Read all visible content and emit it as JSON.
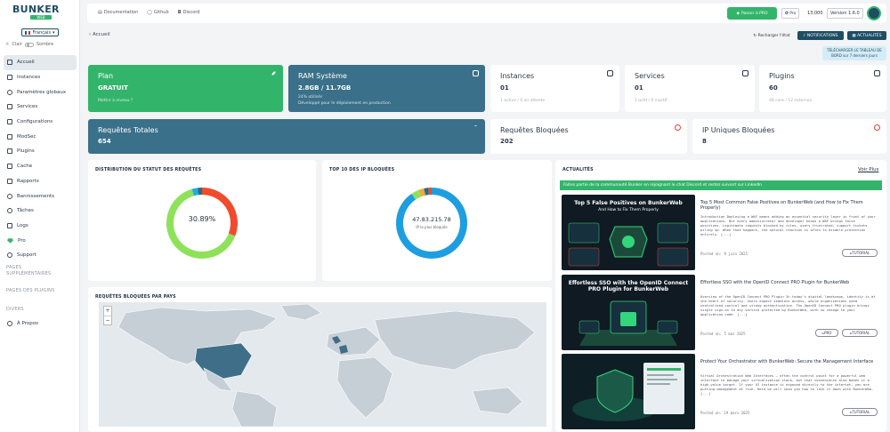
{
  "sidebar": {
    "logo": "BUNKER",
    "logo_badge": "WEB",
    "language": "Français",
    "theme_light": "Clair",
    "theme_dark": "Sombre",
    "items": [
      {
        "label": "Accueil",
        "icon": "home-icon",
        "active": true
      },
      {
        "label": "Instances",
        "icon": "server-icon"
      },
      {
        "label": "Paramètres globaux",
        "icon": "globe-icon"
      },
      {
        "label": "Services",
        "icon": "grid-icon"
      },
      {
        "label": "Configurations",
        "icon": "file-icon"
      },
      {
        "label": "ModSec",
        "icon": "shield-icon"
      },
      {
        "label": "Plugins",
        "icon": "puzzle-icon"
      },
      {
        "label": "Cache",
        "icon": "database-icon"
      },
      {
        "label": "Rapports",
        "icon": "flag-icon"
      },
      {
        "label": "Bannissements",
        "icon": "ban-icon"
      },
      {
        "label": "Tâches",
        "icon": "clock-icon"
      },
      {
        "label": "Logs",
        "icon": "list-icon"
      },
      {
        "label": "Pro",
        "icon": "diamond-icon"
      },
      {
        "label": "Support",
        "icon": "support-icon"
      }
    ],
    "section_extra": "PAGES SUPPLÉMENTAIRES",
    "section_plugins": "PAGES DES PLUGINS",
    "section_misc": "DIVERS",
    "about": "À Propos"
  },
  "topbar": {
    "links": [
      "Documentation",
      "Github",
      "Discord"
    ],
    "pro_button": "Passer à PRO",
    "plan_pill": "Pro",
    "counter": "13,000",
    "version": "Version 1.6.0"
  },
  "breadcrumb": "Accueil",
  "actions": {
    "refresh": "Recharger l'état",
    "notifications": "NOTIFICATIONS",
    "news": "ACTUALITÉS"
  },
  "notice": "TÉLÉCHARGER LE TABLEAU DE BORD sur 7 derniers jours",
  "cards": {
    "plan": {
      "title": "Plan",
      "value": "GRATUIT",
      "sub": "Mettre à niveau ?"
    },
    "ram": {
      "title": "RAM Système",
      "value": "2.8GB / 11.7GB",
      "sub1": "24% utilisés",
      "sub2": "Développé pour le déploiement en production"
    },
    "instances": {
      "title": "Instances",
      "value": "01",
      "sub": "1 active / 0 en attente"
    },
    "services": {
      "title": "Services",
      "value": "01",
      "sub": "1 actif / 0 inactif"
    },
    "plugins": {
      "title": "Plugins",
      "value": "60",
      "sub": "48 core / 12 externes"
    },
    "requests": {
      "title": "Requêtes Totales",
      "value": "654"
    },
    "blocked": {
      "title": "Requêtes Bloquées",
      "value": "202"
    },
    "unique_ips": {
      "title": "IP Uniques Bloquées",
      "value": "8"
    }
  },
  "panels": {
    "status_title": "DISTRIBUTION DU STATUT DES REQUÊTES",
    "status_center": "30.89%",
    "top_ip_title": "TOP 10 DES IP BLOQUÉES",
    "top_ip_center": "47.83.215.78",
    "top_ip_center_sub": "IP la plus bloquée",
    "map_title": "REQUÊTES BLOQUÉES PAR PAYS",
    "map_zoom_in": "+",
    "map_zoom_out": "−"
  },
  "chart_data": [
    {
      "type": "pie",
      "title": "DISTRIBUTION DU STATUT DES REQUÊTES",
      "labels": [
        "",
        "",
        "",
        ""
      ],
      "values": [
        30.89,
        64.5,
        2.6,
        2.0
      ],
      "colors": [
        "#f04b2d",
        "#8ee25a",
        "#26a9e0",
        "#1e6f8c"
      ]
    },
    {
      "type": "pie",
      "title": "TOP 10 DES IP BLOQUÉES",
      "labels": [
        "47.83.215.78",
        "",
        "",
        "",
        ""
      ],
      "values": [
        90.5,
        3.5,
        2.5,
        2.0,
        1.5
      ],
      "colors": [
        "#1d9ee0",
        "#8ee25a",
        "#f3a93b",
        "#1e6f8c",
        "#f04b2d"
      ]
    }
  ],
  "news": {
    "title": "ACTUALITÉS",
    "see_more": "Voir Plus",
    "banner": "Faites partie de la communauté Bunker en rejoignant le chat Discord et restez suivant sur LinkedIn",
    "items": [
      {
        "image_headline": "Top 5 False Positives on BunkerWeb",
        "image_sub": "And How to Fix Them Properly",
        "title": "Top 5 Most Common False Positives on BunkerWeb (and How to Fix Them Properly)",
        "body": "Introduction Deploying a WAF means adding an essential security layer in front of your applications. But every administrator and developer knows a WAF brings false positives. Legitimate requests blocked by rules, users frustrated, support tickets piling up. When that happens, the natural reaction is often to disable protection entirely. [...]",
        "date": "Posted on: 9 juin 2025",
        "tags": [
          "TUTORIAL"
        ]
      },
      {
        "image_headline": "Effortless SSO with the OpenID Connect PRO Plugin for BunkerWeb",
        "image_sub": "",
        "title": "Effortless SSO with the OpenID Connect PRO Plugin for BunkerWeb",
        "body": "Overview of the OpenID Connect PRO Plugin In today's digital landscape, identity is at the heart of security. Users expect seamless access, while organizations need centralized control and strong authentication. The OpenID Connect PRO plugin brings single sign-on to any service protected by BunkerWeb, with no change to your application code. [...]",
        "date": "Posted on: 5 mai 2025",
        "tags": [
          "PRO",
          "TUTORIAL"
        ]
      },
      {
        "image_headline": "",
        "image_sub": "",
        "title": "Protect Your Orchestrator with BunkerWeb: Secure the Management Interface",
        "body": "Virtual Orchestration Web Interfaces — often the control point for a powerful web interface to manage your virtualization stack, but that convenience also makes it a high-value target. If your UI instance is exposed directly to the internet, you are putting management at risk. Here we will show you how to lock it down with BunkerWeb. [...]",
        "date": "Posted on: 19 mars 2025",
        "tags": [
          "TUTORIAL"
        ]
      }
    ]
  },
  "colors": {
    "brand_dark": "#1e4d64",
    "brand_green": "#33b46b",
    "card_teal": "#3a7089",
    "background": "#f2f4f6"
  }
}
